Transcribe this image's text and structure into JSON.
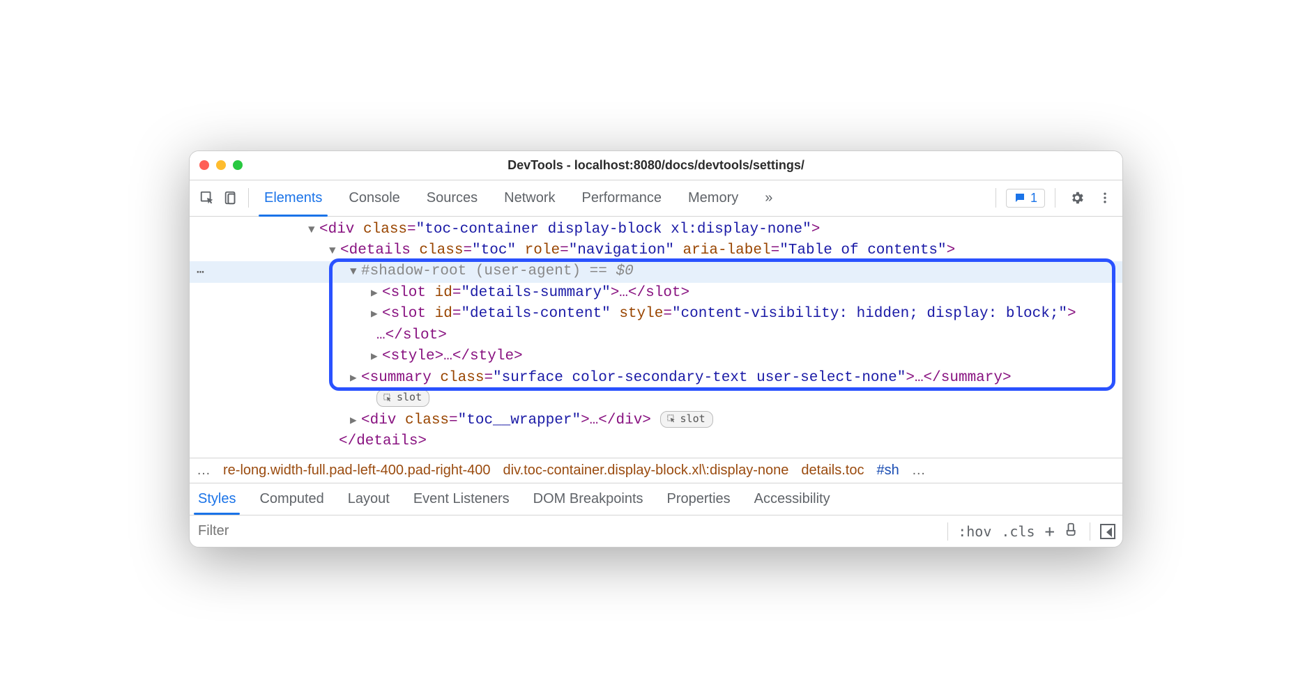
{
  "window": {
    "title": "DevTools - localhost:8080/docs/devtools/settings/"
  },
  "toolbar": {
    "tabs": [
      "Elements",
      "Console",
      "Sources",
      "Network",
      "Performance",
      "Memory"
    ],
    "active": "Elements",
    "overflow": "»",
    "issues_count": "1"
  },
  "dom": {
    "l0": {
      "open": "<div ",
      "a1": "class",
      "v1": "\"toc-container display-block xl:display-none\"",
      "close": ">"
    },
    "l1": {
      "open": "<details ",
      "a1": "class",
      "v1": "\"toc\"",
      "a2": "role",
      "v2": "\"navigation\"",
      "a3": "aria-label",
      "v3": "\"Table of contents\"",
      "close": ">"
    },
    "l2": {
      "text": "#shadow-root (user-agent)",
      "suffix": " == ",
      "var": "$0"
    },
    "l3": {
      "open": "<slot ",
      "a1": "id",
      "v1": "\"details-summary\"",
      "mid": ">…</",
      "close": "slot>"
    },
    "l4": {
      "open": "<slot ",
      "a1": "id",
      "v1": "\"details-content\"",
      "a2": "style",
      "v2": "\"content-visibility: hidden; display: block;\"",
      "close": ">"
    },
    "l4b": {
      "text": "…</",
      "close": "slot>"
    },
    "l5": {
      "open": "<style>",
      "mid": "…",
      "close": "</style>"
    },
    "l6": {
      "open": "<summary ",
      "a1": "class",
      "v1": "\"surface color-secondary-text user-select-none\"",
      "mid": ">…</",
      "close": "summary>"
    },
    "l7": {
      "open": "<div ",
      "a1": "class",
      "v1": "\"toc__wrapper\"",
      "mid": ">…</",
      "close": "div>"
    },
    "l8": {
      "text": "</details>"
    },
    "slot_pill": "slot"
  },
  "crumbs": {
    "left_ellipsis": "…",
    "c1": "re-long.width-full.pad-left-400.pad-right-400",
    "c2": "div.toc-container.display-block.xl\\:display-none",
    "c3": "details.toc",
    "c4": "#sh",
    "right_ellipsis": "…"
  },
  "subtabs": {
    "items": [
      "Styles",
      "Computed",
      "Layout",
      "Event Listeners",
      "DOM Breakpoints",
      "Properties",
      "Accessibility"
    ],
    "active": "Styles"
  },
  "filter": {
    "placeholder": "Filter",
    "hov": ":hov",
    "cls": ".cls",
    "plus": "+"
  }
}
